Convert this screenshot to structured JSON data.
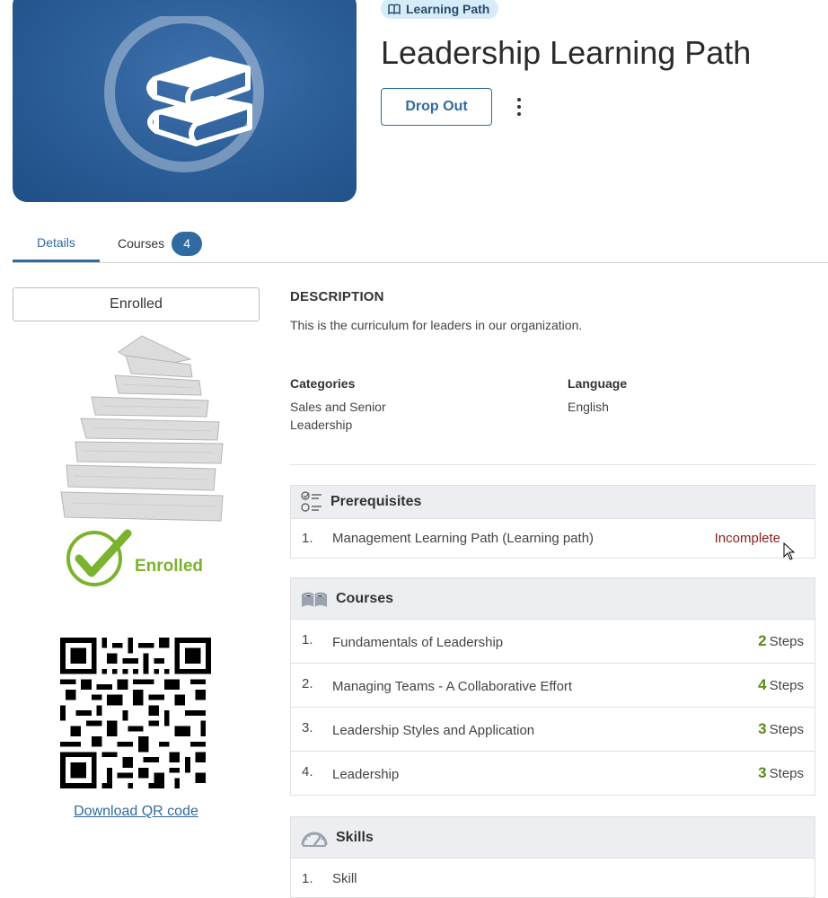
{
  "header": {
    "type_badge": "Learning Path",
    "title": "Leadership Learning Path",
    "drop_out_label": "Drop Out"
  },
  "tabs": [
    {
      "label": "Details",
      "active": true
    },
    {
      "label": "Courses",
      "count": "4"
    }
  ],
  "sidebar": {
    "enrolled_label": "Enrolled",
    "stamp_text": "Enrolled",
    "download_qr_label": "Download QR code"
  },
  "description": {
    "heading": "DESCRIPTION",
    "text": "This is the curriculum for leaders in our organization."
  },
  "meta": {
    "categories_label": "Categories",
    "categories_value": "Sales and Senior Leadership",
    "language_label": "Language",
    "language_value": "English"
  },
  "prerequisites": {
    "heading": "Prerequisites",
    "items": [
      {
        "num": "1.",
        "name": "Management Learning Path (Learning path)",
        "status": "Incomplete"
      }
    ]
  },
  "courses": {
    "heading": "Courses",
    "steps_word": "Steps",
    "items": [
      {
        "num": "1.",
        "name": "Fundamentals of Leadership",
        "steps": "2"
      },
      {
        "num": "2.",
        "name": "Managing Teams - A Collaborative Effort",
        "steps": "4"
      },
      {
        "num": "3.",
        "name": "Leadership Styles and Application",
        "steps": "3"
      },
      {
        "num": "4.",
        "name": "Leadership",
        "steps": "3"
      }
    ]
  },
  "skills": {
    "heading": "Skills",
    "items": [
      {
        "num": "1.",
        "name": "Skill"
      }
    ]
  },
  "colors": {
    "accent": "#2f6aa1",
    "hero_bg": "#2d5f99",
    "enrolled_green": "#7bb32e",
    "steps_green": "#5a8a1a",
    "incomplete_red": "#8b1a1a"
  },
  "icons": [
    "books-icon",
    "open-book-icon",
    "more-vertical-icon",
    "checklist-icon",
    "open-book-icon",
    "gauge-icon",
    "checkmark-icon",
    "cursor-icon"
  ]
}
